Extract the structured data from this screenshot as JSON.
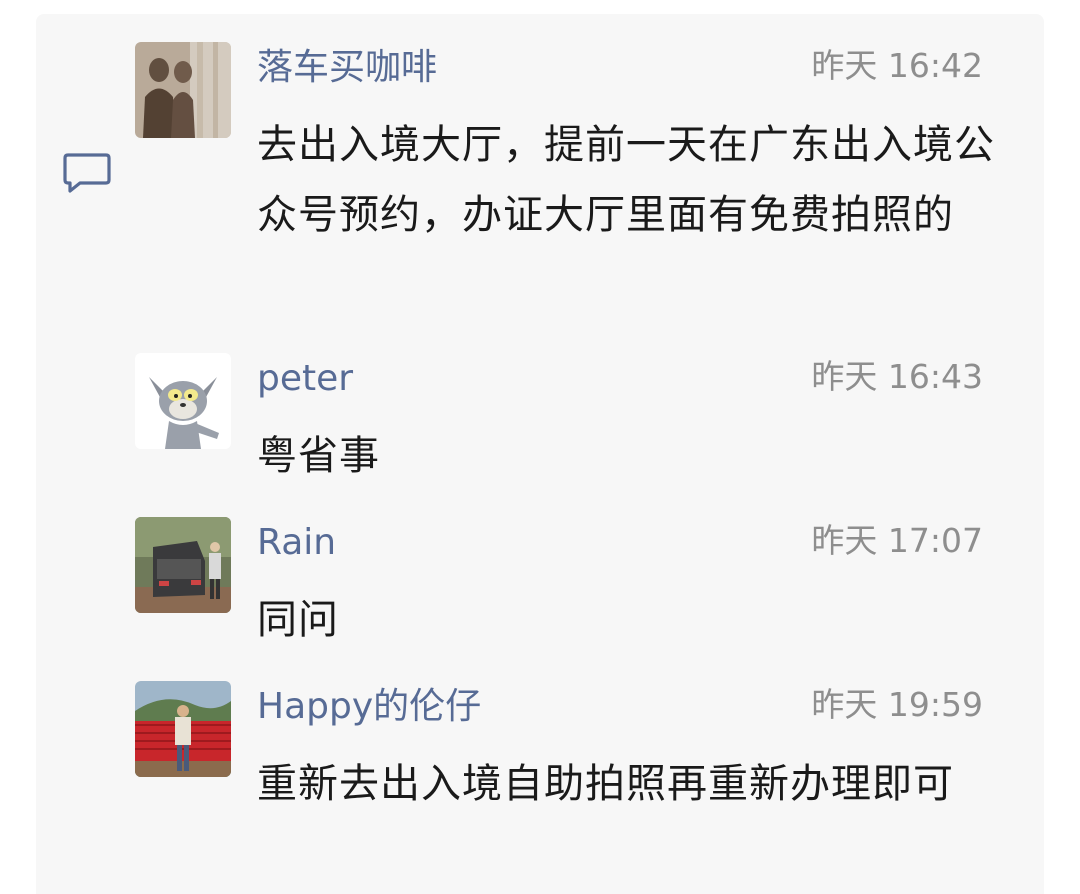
{
  "comment_icon": "comment-bubble-icon",
  "comments": [
    {
      "name": "落车买咖啡",
      "time": "昨天 16:42",
      "text": "去出入境大厅，提前一天在广东出入境公众号预约，办证大厅里面有免费拍照的",
      "avatar": "silhouette-photo-avatar"
    },
    {
      "name": "peter",
      "time": "昨天 16:43",
      "text": "粤省事",
      "avatar": "cartoon-cat-avatar"
    },
    {
      "name": "Rain",
      "time": "昨天 17:07",
      "text": "同问",
      "avatar": "car-photo-avatar"
    },
    {
      "name": "Happy的伦仔",
      "time": "昨天 19:59",
      "text": "重新去出入境自助拍照再重新办理即可",
      "avatar": "outdoor-person-avatar"
    }
  ],
  "colors": {
    "name": "#576b95",
    "time": "#8e8e8e",
    "text": "#1a1a1a",
    "panel": "#f7f7f7"
  }
}
